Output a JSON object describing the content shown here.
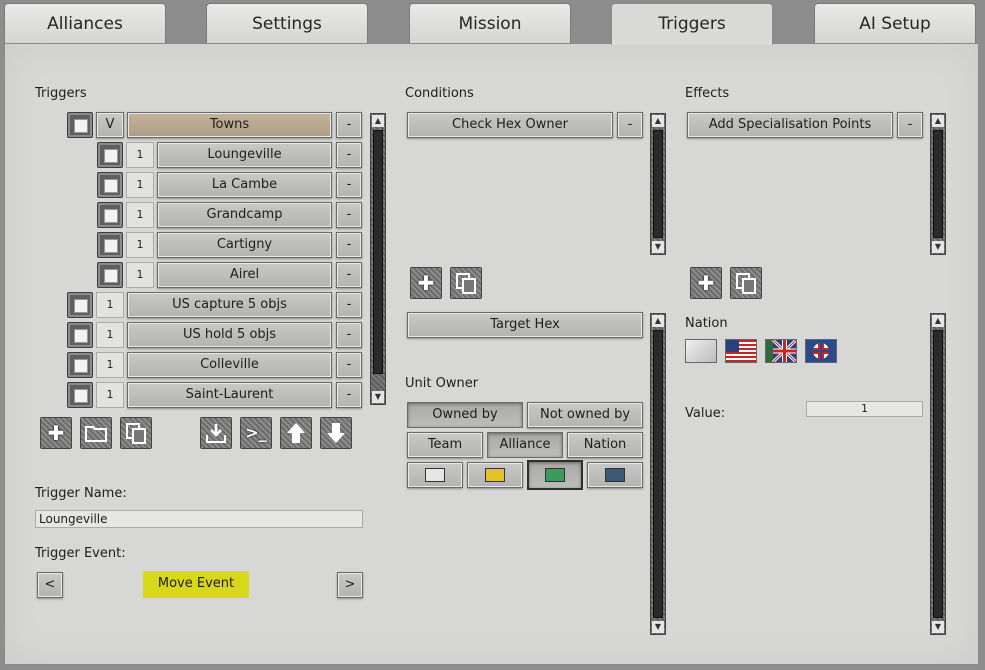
{
  "tabs": [
    "Alliances",
    "Settings",
    "Mission",
    "Triggers",
    "AI Setup"
  ],
  "triggers": {
    "heading": "Triggers",
    "root": {
      "flag": "V",
      "label": "Towns",
      "remove": "-"
    },
    "children": [
      {
        "count": "1",
        "label": "Loungeville",
        "remove": "-"
      },
      {
        "count": "1",
        "label": "La Cambe",
        "remove": "-"
      },
      {
        "count": "1",
        "label": "Grandcamp",
        "remove": "-"
      },
      {
        "count": "1",
        "label": "Cartigny",
        "remove": "-"
      },
      {
        "count": "1",
        "label": "Airel",
        "remove": "-"
      }
    ],
    "items": [
      {
        "count": "1",
        "label": "US capture 5 objs",
        "remove": "-"
      },
      {
        "count": "1",
        "label": "US hold 5 objs",
        "remove": "-"
      },
      {
        "count": "1",
        "label": "Colleville",
        "remove": "-"
      },
      {
        "count": "1",
        "label": "Saint-Laurent",
        "remove": "-"
      }
    ],
    "toolbar": [
      "plus-icon",
      "folder-icon",
      "copy-icon",
      "import-icon",
      "console-icon",
      "arrow-up-icon",
      "arrow-down-icon"
    ],
    "name_label": "Trigger Name:",
    "name_value": "Loungeville",
    "event_label": "Trigger Event:",
    "event_prev": "<",
    "event_value": "Move Event",
    "event_next": ">"
  },
  "conditions": {
    "heading": "Conditions",
    "items": [
      {
        "label": "Check Hex Owner",
        "remove": "-"
      }
    ],
    "target_label": "Target Hex",
    "unit_owner_label": "Unit Owner",
    "owned_by": "Owned by",
    "not_owned_by": "Not owned by",
    "team": "Team",
    "alliance": "Alliance",
    "nation": "Nation",
    "alliance_colors": [
      "#e6e6e6",
      "#e5c22a",
      "#3c9b5a",
      "#3c5a78"
    ]
  },
  "effects": {
    "heading": "Effects",
    "items": [
      {
        "label": "Add Specialisation Points",
        "remove": "-"
      }
    ],
    "nation_label": "Nation",
    "value_label": "Value:",
    "value": "1"
  },
  "colors": {
    "event_highlight": "#d8d81a",
    "root_trigger": "#bfae93"
  }
}
